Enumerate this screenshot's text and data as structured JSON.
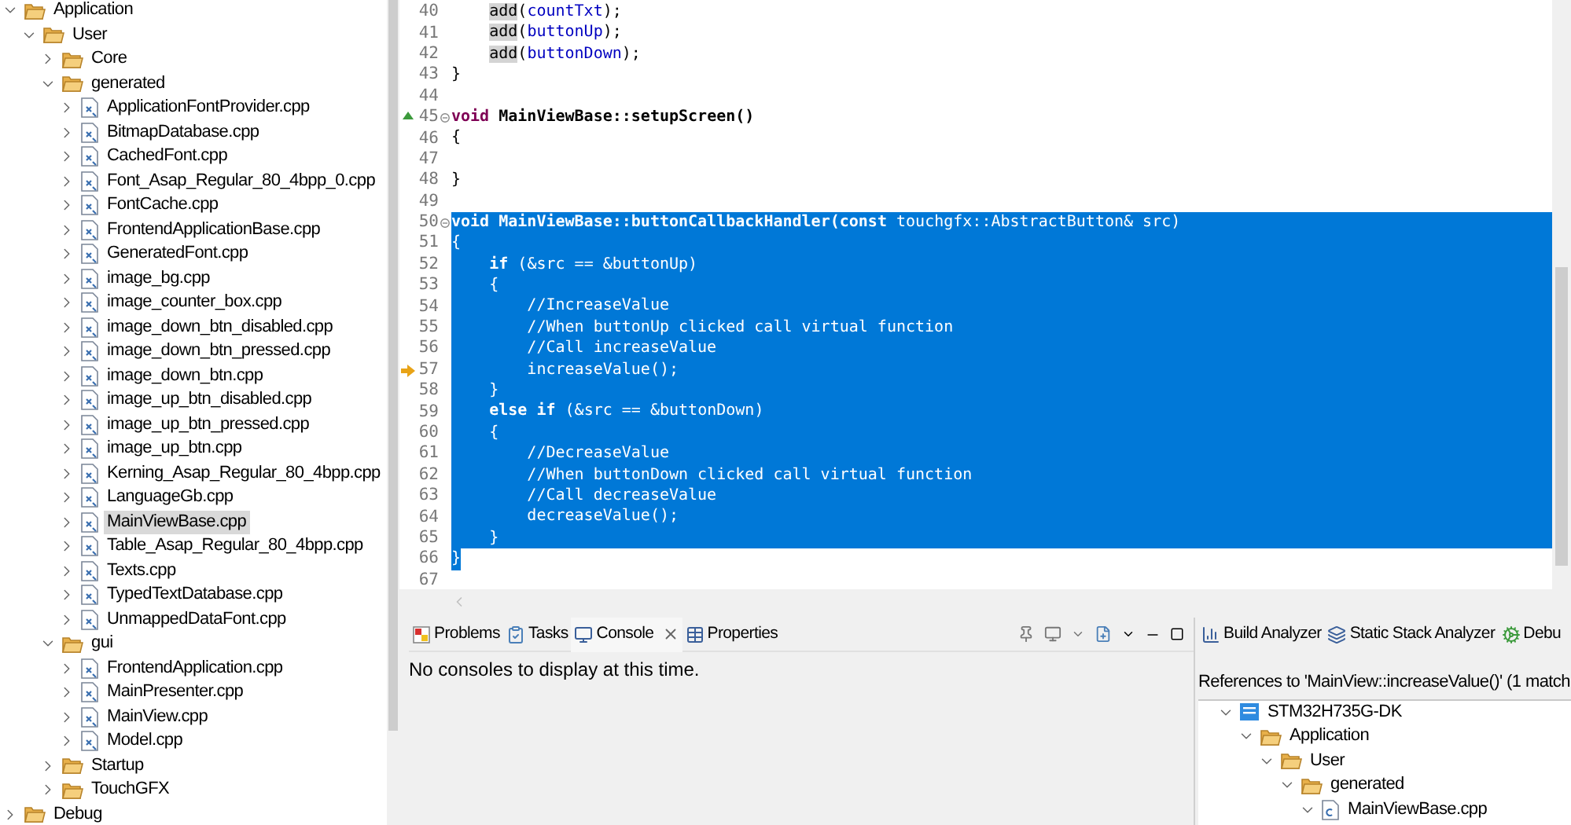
{
  "project_explorer": {
    "tree": [
      {
        "kind": "folder",
        "label": "Application",
        "expanded": true,
        "selected": false,
        "children": [
          {
            "kind": "folder",
            "label": "User",
            "expanded": true,
            "selected": false,
            "children": [
              {
                "kind": "folder",
                "label": "Core",
                "expanded": false,
                "selected": false
              },
              {
                "kind": "folder",
                "label": "generated",
                "expanded": true,
                "selected": false,
                "children": [
                  {
                    "kind": "file",
                    "label": "ApplicationFontProvider.cpp",
                    "expanded": false,
                    "selected": false
                  },
                  {
                    "kind": "file",
                    "label": "BitmapDatabase.cpp",
                    "expanded": false,
                    "selected": false
                  },
                  {
                    "kind": "file",
                    "label": "CachedFont.cpp",
                    "expanded": false,
                    "selected": false
                  },
                  {
                    "kind": "file",
                    "label": "Font_Asap_Regular_80_4bpp_0.cpp",
                    "expanded": false,
                    "selected": false
                  },
                  {
                    "kind": "file",
                    "label": "FontCache.cpp",
                    "expanded": false,
                    "selected": false
                  },
                  {
                    "kind": "file",
                    "label": "FrontendApplicationBase.cpp",
                    "expanded": false,
                    "selected": false
                  },
                  {
                    "kind": "file",
                    "label": "GeneratedFont.cpp",
                    "expanded": false,
                    "selected": false
                  },
                  {
                    "kind": "file",
                    "label": "image_bg.cpp",
                    "expanded": false,
                    "selected": false
                  },
                  {
                    "kind": "file",
                    "label": "image_counter_box.cpp",
                    "expanded": false,
                    "selected": false
                  },
                  {
                    "kind": "file",
                    "label": "image_down_btn_disabled.cpp",
                    "expanded": false,
                    "selected": false
                  },
                  {
                    "kind": "file",
                    "label": "image_down_btn_pressed.cpp",
                    "expanded": false,
                    "selected": false
                  },
                  {
                    "kind": "file",
                    "label": "image_down_btn.cpp",
                    "expanded": false,
                    "selected": false
                  },
                  {
                    "kind": "file",
                    "label": "image_up_btn_disabled.cpp",
                    "expanded": false,
                    "selected": false
                  },
                  {
                    "kind": "file",
                    "label": "image_up_btn_pressed.cpp",
                    "expanded": false,
                    "selected": false
                  },
                  {
                    "kind": "file",
                    "label": "image_up_btn.cpp",
                    "expanded": false,
                    "selected": false
                  },
                  {
                    "kind": "file",
                    "label": "Kerning_Asap_Regular_80_4bpp.cpp",
                    "expanded": false,
                    "selected": false
                  },
                  {
                    "kind": "file",
                    "label": "LanguageGb.cpp",
                    "expanded": false,
                    "selected": false
                  },
                  {
                    "kind": "file",
                    "label": "MainViewBase.cpp",
                    "expanded": false,
                    "selected": true
                  },
                  {
                    "kind": "file",
                    "label": "Table_Asap_Regular_80_4bpp.cpp",
                    "expanded": false,
                    "selected": false
                  },
                  {
                    "kind": "file",
                    "label": "Texts.cpp",
                    "expanded": false,
                    "selected": false
                  },
                  {
                    "kind": "file",
                    "label": "TypedTextDatabase.cpp",
                    "expanded": false,
                    "selected": false
                  },
                  {
                    "kind": "file",
                    "label": "UnmappedDataFont.cpp",
                    "expanded": false,
                    "selected": false
                  }
                ]
              },
              {
                "kind": "folder",
                "label": "gui",
                "expanded": true,
                "selected": false,
                "children": [
                  {
                    "kind": "file",
                    "label": "FrontendApplication.cpp",
                    "expanded": false,
                    "selected": false
                  },
                  {
                    "kind": "file",
                    "label": "MainPresenter.cpp",
                    "expanded": false,
                    "selected": false
                  },
                  {
                    "kind": "file",
                    "label": "MainView.cpp",
                    "expanded": false,
                    "selected": false
                  },
                  {
                    "kind": "file",
                    "label": "Model.cpp",
                    "expanded": false,
                    "selected": false
                  }
                ]
              },
              {
                "kind": "folder",
                "label": "Startup",
                "expanded": false,
                "selected": false
              },
              {
                "kind": "folder",
                "label": "TouchGFX",
                "expanded": false,
                "selected": false
              }
            ]
          }
        ]
      },
      {
        "kind": "folder",
        "label": "Debug",
        "expanded": false,
        "selected": false
      }
    ]
  },
  "editor": {
    "lines": [
      {
        "number": "40",
        "kind": "plain",
        "selected": false,
        "fold": false,
        "tokens": [
          {
            "kind": "occurrence",
            "text": "    add"
          },
          {
            "kind": "plain",
            "text": "("
          },
          {
            "kind": "field",
            "text": "countTxt"
          },
          {
            "kind": "plain",
            "text": ");"
          }
        ]
      },
      {
        "number": "41",
        "kind": "plain",
        "selected": false,
        "fold": false,
        "tokens": [
          {
            "kind": "occurrence",
            "text": "    add"
          },
          {
            "kind": "plain",
            "text": "("
          },
          {
            "kind": "field",
            "text": "buttonUp"
          },
          {
            "kind": "plain",
            "text": ");"
          }
        ]
      },
      {
        "number": "42",
        "kind": "plain",
        "selected": false,
        "fold": false,
        "tokens": [
          {
            "kind": "occurrence",
            "text": "    add"
          },
          {
            "kind": "plain",
            "text": "("
          },
          {
            "kind": "field",
            "text": "buttonDown"
          },
          {
            "kind": "plain",
            "text": ");"
          }
        ]
      },
      {
        "number": "43",
        "kind": "plain",
        "selected": false,
        "fold": false,
        "tokens": [
          {
            "kind": "plain",
            "text": "}"
          }
        ]
      },
      {
        "number": "44",
        "kind": "plain",
        "selected": false,
        "fold": false
      },
      {
        "number": "45",
        "kind": "override",
        "selected": false,
        "fold": true,
        "tokens": [
          {
            "kind": "keyword",
            "text": "void"
          },
          {
            "kind": "bold",
            "text": " MainViewBase::setupScreen()"
          }
        ]
      },
      {
        "number": "46",
        "kind": "plain",
        "selected": false,
        "fold": false,
        "tokens": [
          {
            "kind": "plain",
            "text": "{"
          }
        ]
      },
      {
        "number": "47",
        "kind": "plain",
        "selected": false,
        "fold": false
      },
      {
        "number": "48",
        "kind": "plain",
        "selected": false,
        "fold": false,
        "tokens": [
          {
            "kind": "plain",
            "text": "}"
          }
        ]
      },
      {
        "number": "49",
        "kind": "plain",
        "selected": false,
        "fold": false
      },
      {
        "number": "50",
        "kind": "plain",
        "selected": true,
        "fold": true,
        "tokens": [
          {
            "kind": "keyword",
            "text": "void"
          },
          {
            "kind": "bold",
            "text": " MainViewBase::buttonCallbackHandler("
          },
          {
            "kind": "keyword",
            "text": "const"
          },
          {
            "kind": "plain",
            "text": " touchgfx::AbstractButton& src)"
          }
        ]
      },
      {
        "number": "51",
        "kind": "plain",
        "selected": true,
        "fold": false,
        "tokens": [
          {
            "kind": "plain",
            "text": "{"
          }
        ]
      },
      {
        "number": "52",
        "kind": "plain",
        "selected": true,
        "fold": false,
        "tokens": [
          {
            "kind": "keyword",
            "text": "    if"
          },
          {
            "kind": "plain",
            "text": " (&src == &buttonUp)"
          }
        ]
      },
      {
        "number": "53",
        "kind": "plain",
        "selected": true,
        "fold": false,
        "tokens": [
          {
            "kind": "plain",
            "text": "    {"
          }
        ]
      },
      {
        "number": "54",
        "kind": "plain",
        "selected": true,
        "fold": false,
        "tokens": [
          {
            "kind": "comment",
            "text": "        //IncreaseValue"
          }
        ]
      },
      {
        "number": "55",
        "kind": "plain",
        "selected": true,
        "fold": false,
        "tokens": [
          {
            "kind": "comment",
            "text": "        //When buttonUp clicked call virtual function"
          }
        ]
      },
      {
        "number": "56",
        "kind": "plain",
        "selected": true,
        "fold": false,
        "tokens": [
          {
            "kind": "comment",
            "text": "        //Call increaseValue"
          }
        ]
      },
      {
        "number": "57",
        "kind": "instruction",
        "selected": true,
        "fold": false,
        "tokens": [
          {
            "kind": "plain",
            "text": "        increaseValue();"
          }
        ]
      },
      {
        "number": "58",
        "kind": "plain",
        "selected": true,
        "fold": false,
        "tokens": [
          {
            "kind": "plain",
            "text": "    }"
          }
        ]
      },
      {
        "number": "59",
        "kind": "plain",
        "selected": true,
        "fold": false,
        "tokens": [
          {
            "kind": "keyword",
            "text": "    else if"
          },
          {
            "kind": "plain",
            "text": " (&src == &buttonDown)"
          }
        ]
      },
      {
        "number": "60",
        "kind": "plain",
        "selected": true,
        "fold": false,
        "tokens": [
          {
            "kind": "plain",
            "text": "    {"
          }
        ]
      },
      {
        "number": "61",
        "kind": "plain",
        "selected": true,
        "fold": false,
        "tokens": [
          {
            "kind": "comment",
            "text": "        //DecreaseValue"
          }
        ]
      },
      {
        "number": "62",
        "kind": "plain",
        "selected": true,
        "fold": false,
        "tokens": [
          {
            "kind": "comment",
            "text": "        //When buttonDown clicked call virtual function"
          }
        ]
      },
      {
        "number": "63",
        "kind": "plain",
        "selected": true,
        "fold": false,
        "tokens": [
          {
            "kind": "comment",
            "text": "        //Call decreaseValue"
          }
        ]
      },
      {
        "number": "64",
        "kind": "plain",
        "selected": true,
        "fold": false,
        "tokens": [
          {
            "kind": "plain",
            "text": "        decreaseValue();"
          }
        ]
      },
      {
        "number": "65",
        "kind": "plain",
        "selected": true,
        "fold": false,
        "tokens": [
          {
            "kind": "plain",
            "text": "    }"
          }
        ]
      },
      {
        "number": "66",
        "kind": "selection_end",
        "selected": true,
        "fold": false,
        "tokens": [
          {
            "kind": "plain",
            "text": "}"
          }
        ]
      },
      {
        "number": "67",
        "kind": "plain",
        "selected": false,
        "fold": false
      }
    ]
  },
  "console_view": {
    "tabs": [
      {
        "kind": "problems",
        "label": "Problems",
        "selected": false
      },
      {
        "kind": "tasks",
        "label": "Tasks",
        "selected": false
      },
      {
        "kind": "console",
        "label": "Console",
        "selected": true
      },
      {
        "kind": "properties",
        "label": "Properties",
        "selected": false
      }
    ],
    "message": "No consoles to display at this time."
  },
  "analyzer_view": {
    "tabs": [
      {
        "kind": "build",
        "label": "Build Analyzer",
        "selected": false
      },
      {
        "kind": "stack",
        "label": "Static Stack Analyzer",
        "selected": false
      },
      {
        "kind": "debug",
        "label": "Debu",
        "selected": false
      }
    ],
    "title": "References to 'MainView::increaseValue()' (1 match",
    "tree": [
      {
        "kind": "project",
        "label": "STM32H735G-DK",
        "expanded": true,
        "selected": false,
        "children": [
          {
            "kind": "folder",
            "label": "Application",
            "expanded": true,
            "selected": false,
            "children": [
              {
                "kind": "folder",
                "label": "User",
                "expanded": true,
                "selected": false,
                "children": [
                  {
                    "kind": "folder",
                    "label": "generated",
                    "expanded": true,
                    "selected": false,
                    "children": [
                      {
                        "kind": "cfile",
                        "label": "MainViewBase.cpp",
                        "expanded": true,
                        "selected": false
                      }
                    ]
                  }
                ]
              }
            ]
          }
        ]
      }
    ]
  }
}
